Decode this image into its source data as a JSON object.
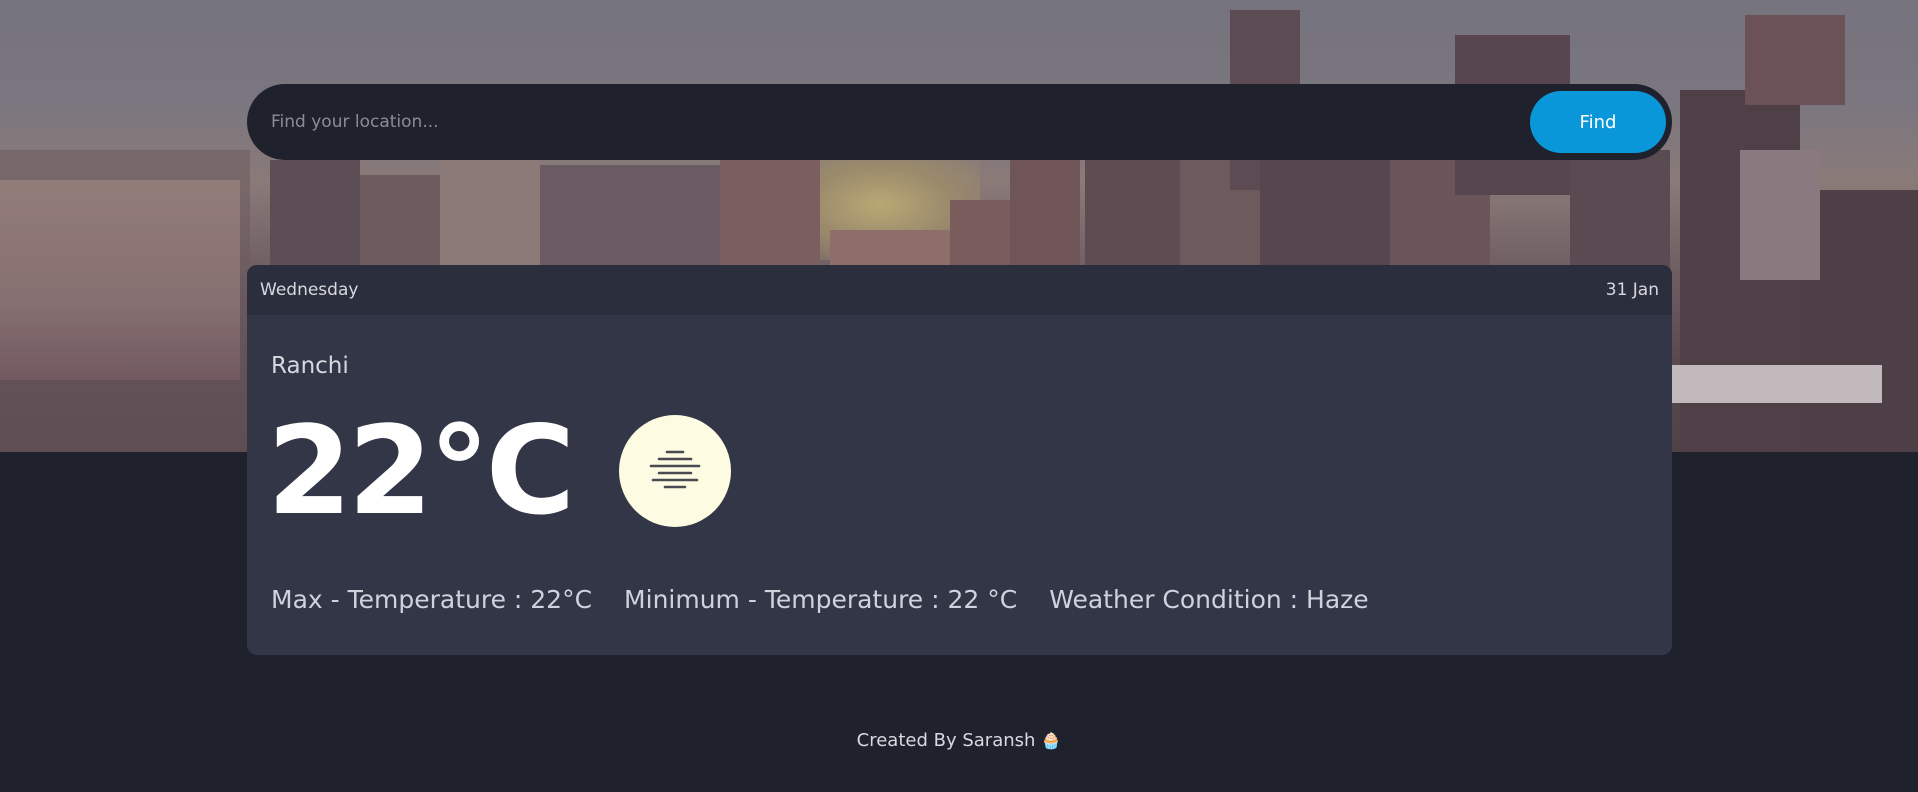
{
  "search": {
    "placeholder": "Find your location...",
    "button_label": "Find"
  },
  "card": {
    "day": "Wednesday",
    "date": "31 Jan",
    "city": "Ranchi",
    "temperature": "22°C",
    "icon": "haze-icon",
    "max_temp": "Max - Temperature : 22°C",
    "min_temp": "Minimum - Temperature : 22 °C",
    "condition": "Weather Condition : Haze"
  },
  "footer": {
    "text": "Created By Saransh",
    "emoji": "🧁"
  },
  "colors": {
    "page_background": "#1f212d",
    "card_background": "#323646",
    "accent": "#0a97d9",
    "icon_circle": "#fdfbe2"
  }
}
